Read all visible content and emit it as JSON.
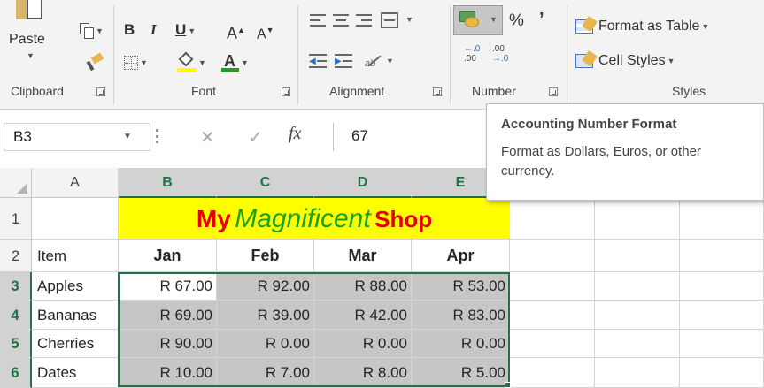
{
  "ribbon": {
    "clipboard": {
      "paste_label": "Paste",
      "group_label": "Clipboard"
    },
    "font": {
      "bold": "B",
      "italic": "I",
      "underline": "U",
      "grow": "A",
      "shrink": "A",
      "font_color_letter": "A",
      "group_label": "Font"
    },
    "alignment": {
      "group_label": "Alignment"
    },
    "number": {
      "percent": "%",
      "comma": "’",
      "inc_decimal_top": "←.0",
      "inc_decimal_bottom": ".00",
      "dec_decimal_top": ".00",
      "dec_decimal_bottom": "→.0",
      "group_label": "Number"
    },
    "styles": {
      "format_as_table": "Format as Table",
      "cell_styles": "Cell Styles",
      "group_label": "Styles"
    }
  },
  "formula_bar": {
    "name_box": "B3",
    "fx_label": "fx",
    "value": "67"
  },
  "tooltip": {
    "title": "Accounting Number Format",
    "body_line1": "Format as Dollars, Euros, or other",
    "body_line2": "currency."
  },
  "columns": [
    "A",
    "B",
    "C",
    "D",
    "E"
  ],
  "rows": [
    "1",
    "2",
    "3",
    "4",
    "5",
    "6"
  ],
  "sheet": {
    "title_part1": "My",
    "title_part2": "Magnificent",
    "title_part3": "Shop",
    "header_item": "Item",
    "months": [
      "Jan",
      "Feb",
      "Mar",
      "Apr"
    ],
    "items": [
      "Apples",
      "Bananas",
      "Cherries",
      "Dates"
    ],
    "values": [
      [
        "R 67.00",
        "R 92.00",
        "R 88.00",
        "R 53.00"
      ],
      [
        "R 69.00",
        "R 39.00",
        "R 42.00",
        "R 83.00"
      ],
      [
        "R 90.00",
        "R 0.00",
        "R 0.00",
        "R 0.00"
      ],
      [
        "R 10.00",
        "R 7.00",
        "R 8.00",
        "R 5.00"
      ]
    ]
  },
  "colors": {
    "accent_green": "#217346",
    "title_fill": "#ffff00",
    "title_red": "#e50000",
    "title_green": "#1aa01a",
    "selection_shade": "#c6c6c6"
  }
}
